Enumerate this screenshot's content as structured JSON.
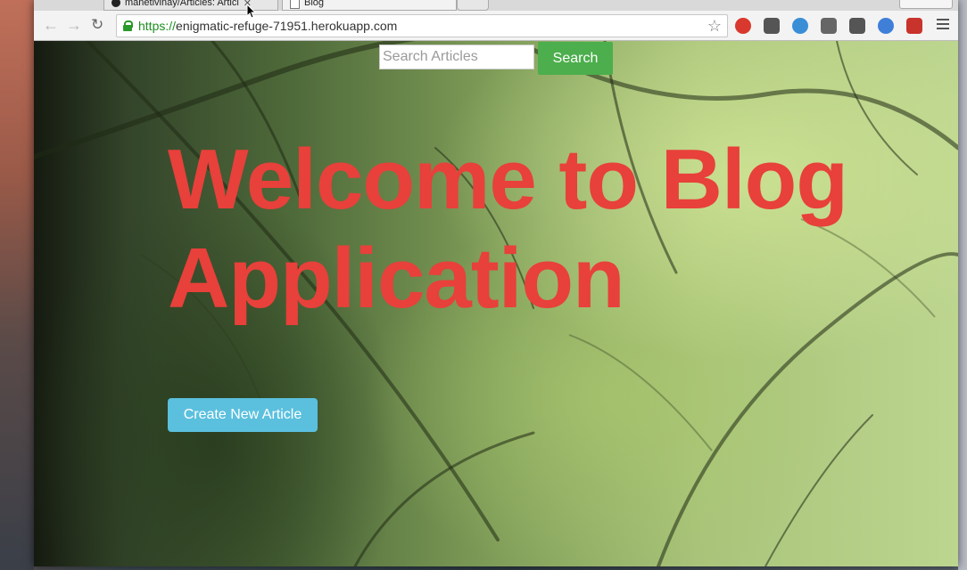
{
  "browser": {
    "tabs": [
      {
        "title": "manetivinay/Articles: Articl",
        "active": false
      },
      {
        "title": "Blog",
        "active": true
      }
    ],
    "url_scheme": "https://",
    "url_host": "enigmatic-refuge-71951.herokuapp.com"
  },
  "page": {
    "search": {
      "placeholder": "Search Articles",
      "value": "",
      "button_label": "Search"
    },
    "hero_title": "Welcome to Blog Application",
    "create_button_label": "Create New Article"
  },
  "colors": {
    "hero_title": "#e8403a",
    "search_button": "#4cae4c",
    "create_button": "#5bc0de"
  },
  "icons": [
    "back-icon",
    "forward-icon",
    "reload-icon",
    "lock-icon",
    "star-icon",
    "extension-icons",
    "menu-icon"
  ]
}
